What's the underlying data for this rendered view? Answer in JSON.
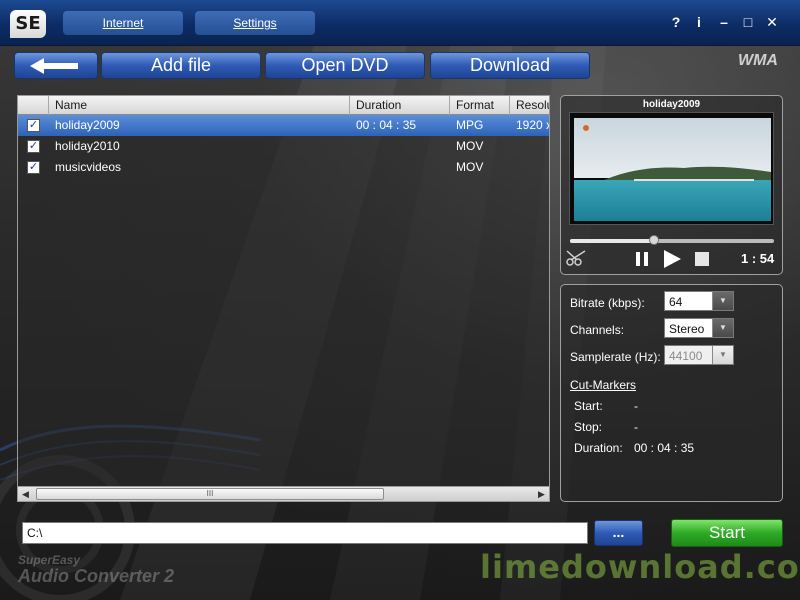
{
  "app": {
    "logo": "SE",
    "top_tabs": [
      "Internet",
      "Settings"
    ],
    "window_controls": [
      "?",
      "i",
      "–",
      "□",
      "✕"
    ],
    "format_badge": "WMA"
  },
  "toolbar": {
    "back_icon": "back-arrow-icon",
    "add_file": "Add file",
    "open_dvd": "Open DVD",
    "download": "Download"
  },
  "file_list": {
    "columns": [
      "Name",
      "Duration",
      "Format",
      "Resolu"
    ],
    "rows": [
      {
        "checked": true,
        "name": "holiday2009",
        "duration": "00 : 04 : 35",
        "format": "MPG",
        "resolution": "1920 x",
        "selected": true
      },
      {
        "checked": true,
        "name": "holiday2010",
        "duration": "",
        "format": "MOV",
        "resolution": "",
        "selected": false
      },
      {
        "checked": true,
        "name": "musicvideos",
        "duration": "",
        "format": "MOV",
        "resolution": "",
        "selected": false
      }
    ],
    "scroll_grip": "III"
  },
  "preview": {
    "title": "holiday2009",
    "time": "1 : 54",
    "seek_fraction": 0.41
  },
  "settings": {
    "bitrate_label": "Bitrate (kbps):",
    "bitrate_value": "64",
    "channels_label": "Channels:",
    "channels_value": "Stereo",
    "samplerate_label": "Samplerate (Hz):",
    "samplerate_value": "44100",
    "cut_markers_title": "Cut-Markers",
    "start_label": "Start:",
    "start_value": "-",
    "stop_label": "Stop:",
    "stop_value": "-",
    "duration_label": "Duration:",
    "duration_value": "00 : 04 : 35"
  },
  "bottom": {
    "path": "C:\\",
    "browse": "...",
    "start": "Start"
  },
  "branding": {
    "line1": "SuperEasy",
    "line2": "Audio Converter 2",
    "watermark": "limedownload.com"
  },
  "colors": {
    "accent_blue": "#2f5bb5",
    "start_green": "#2faa26",
    "selection": "#2d62b8"
  }
}
